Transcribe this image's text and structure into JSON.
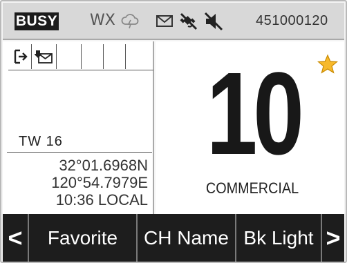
{
  "status_bar": {
    "busy": "BUSY",
    "wx": "WX",
    "icons": [
      "weather-alert-icon",
      "message-icon",
      "gps-off-icon",
      "mute-icon"
    ],
    "mmsi": "451000120"
  },
  "left_panel": {
    "icons": [
      "exit-icon",
      "received-message-icon"
    ],
    "channel_line": "TW 16",
    "latitude": "32°01.6968N",
    "longitude": "120°54.7979E",
    "time": "10:36 LOCAL"
  },
  "channel": {
    "number": "10",
    "name": "COMMERCIAL",
    "favorite_icon": "star-icon",
    "favorite_color": "#f2a900"
  },
  "softkeys": {
    "left": "<",
    "favorite": "Favorite",
    "ch_name": "CH Name",
    "bk_light": "Bk Light",
    "right": ">"
  }
}
